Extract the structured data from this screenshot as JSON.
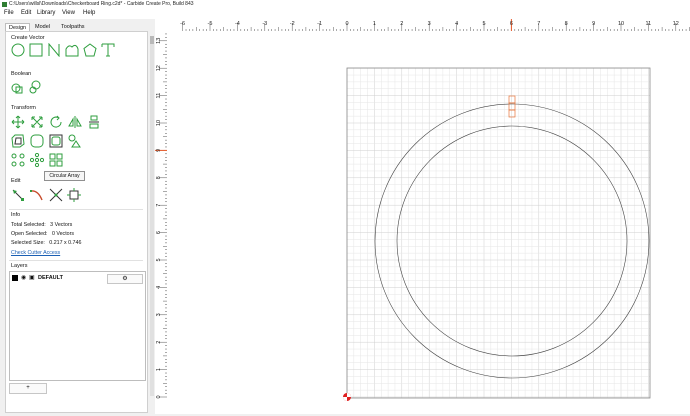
{
  "window": {
    "title": "C:\\Users\\willsl\\Downloads\\Checkerboard Ring.c2d* - Carbide Create Pro, Build 843"
  },
  "menu": [
    "File",
    "Edit",
    "Library",
    "View",
    "Help"
  ],
  "tabs": [
    "Design",
    "Model",
    "Toolpaths"
  ],
  "sections": {
    "create_vector": "Create Vector",
    "boolean": "Boolean",
    "transform": "Transform",
    "edit": "Edit",
    "info": "Info",
    "layers": "Layers"
  },
  "tooltip": "Circular Array",
  "info": {
    "total_selected_label": "Total Selected:",
    "total_selected_value": "3 Vectors",
    "open_selected_label": "Open Selected:",
    "open_selected_value": "0 Vectors",
    "selected_size_label": "Selected Size:",
    "selected_size_value": "0.217 x 0.746",
    "cutter_link": "Check Cutter Access"
  },
  "layers": [
    {
      "name": "DEFAULT"
    }
  ],
  "add_layer_label": "+",
  "ruler": {
    "x_ticks": [
      "-6",
      "-5",
      "-4",
      "-3",
      "-2",
      "-1",
      "0",
      "1",
      "2",
      "3",
      "4",
      "5",
      "6",
      "7",
      "8",
      "9",
      "10",
      "11",
      "12"
    ],
    "y_ticks": [
      "0",
      "1",
      "2",
      "3",
      "4",
      "5",
      "6",
      "7",
      "8",
      "9",
      "10",
      "11",
      "12",
      "13"
    ],
    "x_marker": 6,
    "y_marker": 9
  },
  "colors": {
    "accent": "#2e9e3e",
    "selection": "#e8763a",
    "marker": "#e85a2a"
  }
}
